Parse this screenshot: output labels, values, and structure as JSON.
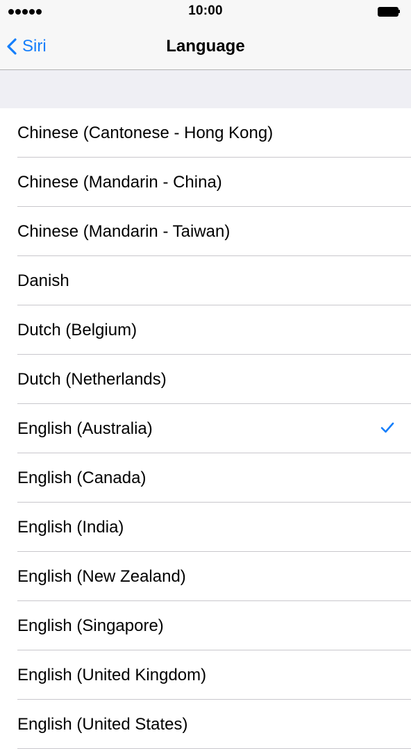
{
  "status_bar": {
    "time": "10:00",
    "signal_icon": "signal-dots-icon",
    "battery_icon": "battery-full-icon"
  },
  "nav": {
    "back_label": "Siri",
    "back_icon": "chevron-left-icon",
    "title": "Language"
  },
  "colors": {
    "accent": "#147efb",
    "section_background": "#efeff4",
    "separator": "#c8c7cc"
  },
  "languages": [
    {
      "label": "Chinese (Cantonese - Hong Kong)",
      "selected": false
    },
    {
      "label": "Chinese (Mandarin - China)",
      "selected": false
    },
    {
      "label": "Chinese (Mandarin - Taiwan)",
      "selected": false
    },
    {
      "label": "Danish",
      "selected": false
    },
    {
      "label": "Dutch (Belgium)",
      "selected": false
    },
    {
      "label": "Dutch (Netherlands)",
      "selected": false
    },
    {
      "label": "English (Australia)",
      "selected": true
    },
    {
      "label": "English (Canada)",
      "selected": false
    },
    {
      "label": "English (India)",
      "selected": false
    },
    {
      "label": "English (New Zealand)",
      "selected": false
    },
    {
      "label": "English (Singapore)",
      "selected": false
    },
    {
      "label": "English (United Kingdom)",
      "selected": false
    },
    {
      "label": "English (United States)",
      "selected": false
    }
  ]
}
